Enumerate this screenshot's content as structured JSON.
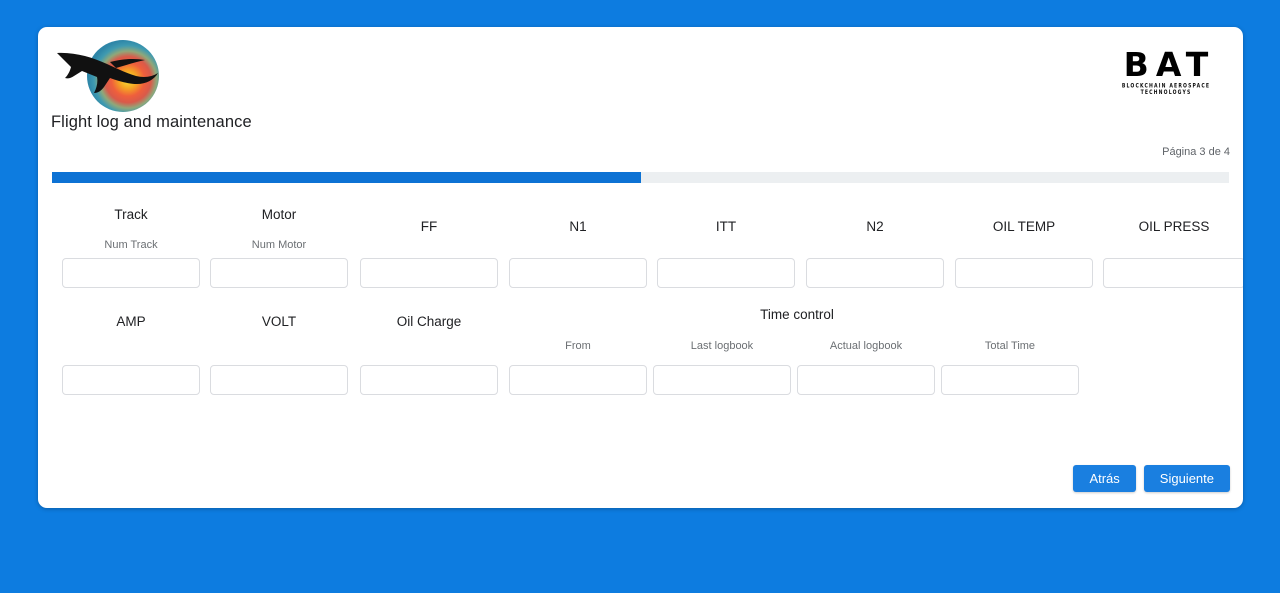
{
  "app": {
    "background_color": "#0d7ce0",
    "card_background": "#ffffff"
  },
  "header": {
    "logo_icon": "airplane-gradient-sphere-logo",
    "page_title": "Flight log and maintenance",
    "brand": {
      "word": "BAT",
      "subtitle": "BLOCKCHAIN AEROSPACE TECHNOLOGYS"
    },
    "page_counter": "Página 3 de 4"
  },
  "progress": {
    "percent": 50,
    "fill_color": "#0d72d4",
    "track_color": "#eceff1"
  },
  "form": {
    "row1": [
      {
        "label": "Track",
        "sublabel": "Num Track",
        "value": "",
        "placeholder": ""
      },
      {
        "label": "Motor",
        "sublabel": "Num Motor",
        "value": "",
        "placeholder": ""
      },
      {
        "label": "FF",
        "sublabel": "",
        "value": "",
        "placeholder": ""
      },
      {
        "label": "N1",
        "sublabel": "",
        "value": "",
        "placeholder": ""
      },
      {
        "label": "ITT",
        "sublabel": "",
        "value": "",
        "placeholder": ""
      },
      {
        "label": "N2",
        "sublabel": "",
        "value": "",
        "placeholder": ""
      },
      {
        "label": "OIL TEMP",
        "sublabel": "",
        "value": "",
        "placeholder": ""
      },
      {
        "label": "OIL PRESS",
        "sublabel": "",
        "value": "",
        "placeholder": ""
      }
    ],
    "row2": [
      {
        "label": "AMP",
        "sublabel": "",
        "value": "",
        "placeholder": ""
      },
      {
        "label": "VOLT",
        "sublabel": "",
        "value": "",
        "placeholder": ""
      },
      {
        "label": "Oil Charge",
        "sublabel": "",
        "value": "",
        "placeholder": ""
      }
    ],
    "time_control": {
      "group_label": "Time control",
      "fields": [
        {
          "label": "From",
          "value": "",
          "placeholder": ""
        },
        {
          "label": "Last logbook",
          "value": "",
          "placeholder": ""
        },
        {
          "label": "Actual logbook",
          "value": "",
          "placeholder": ""
        },
        {
          "label": "Total Time",
          "value": "",
          "placeholder": ""
        }
      ]
    }
  },
  "footer": {
    "back_label": "Atrás",
    "next_label": "Siguiente",
    "button_color": "#1a7fe0"
  }
}
